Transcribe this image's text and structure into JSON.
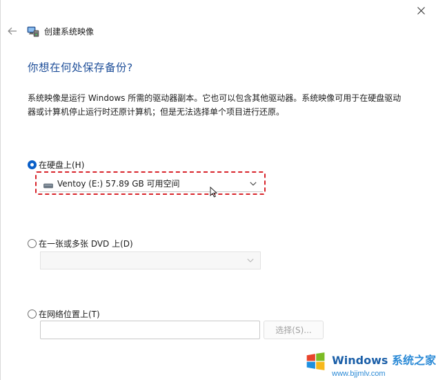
{
  "window": {
    "title": "创建系统映像"
  },
  "page": {
    "heading": "你想在何处保存备份?",
    "description": "系统映像是运行 Windows 所需的驱动器副本。它也可以包含其他驱动器。系统映像可用于在硬盘驱动器或计算机停止运行时还原计算机；但是无法选择单个项目进行还原。"
  },
  "options": {
    "hard_disk": {
      "label": "在硬盘上(H)",
      "selected": true,
      "drive_value": "Ventoy (E:)  57.89 GB 可用空间"
    },
    "dvd": {
      "label": "在一张或多张 DVD 上(D)",
      "selected": false,
      "drive_value": ""
    },
    "network": {
      "label": "在网络位置上(T)",
      "selected": false,
      "path_value": "",
      "browse_label": "选择(S)..."
    }
  },
  "watermark": {
    "brand_en": "Windows",
    "brand_cn": "系统之家",
    "url": "www.bjjmlv.com"
  },
  "colors": {
    "accent": "#0a5fc8",
    "heading": "#1f4f99",
    "highlight": "#d8232a"
  },
  "icons": {
    "close": "close-icon",
    "back": "back-arrow-icon",
    "app": "system-image-backup-icon",
    "drive": "drive-icon",
    "chevron": "chevron-down-icon"
  }
}
